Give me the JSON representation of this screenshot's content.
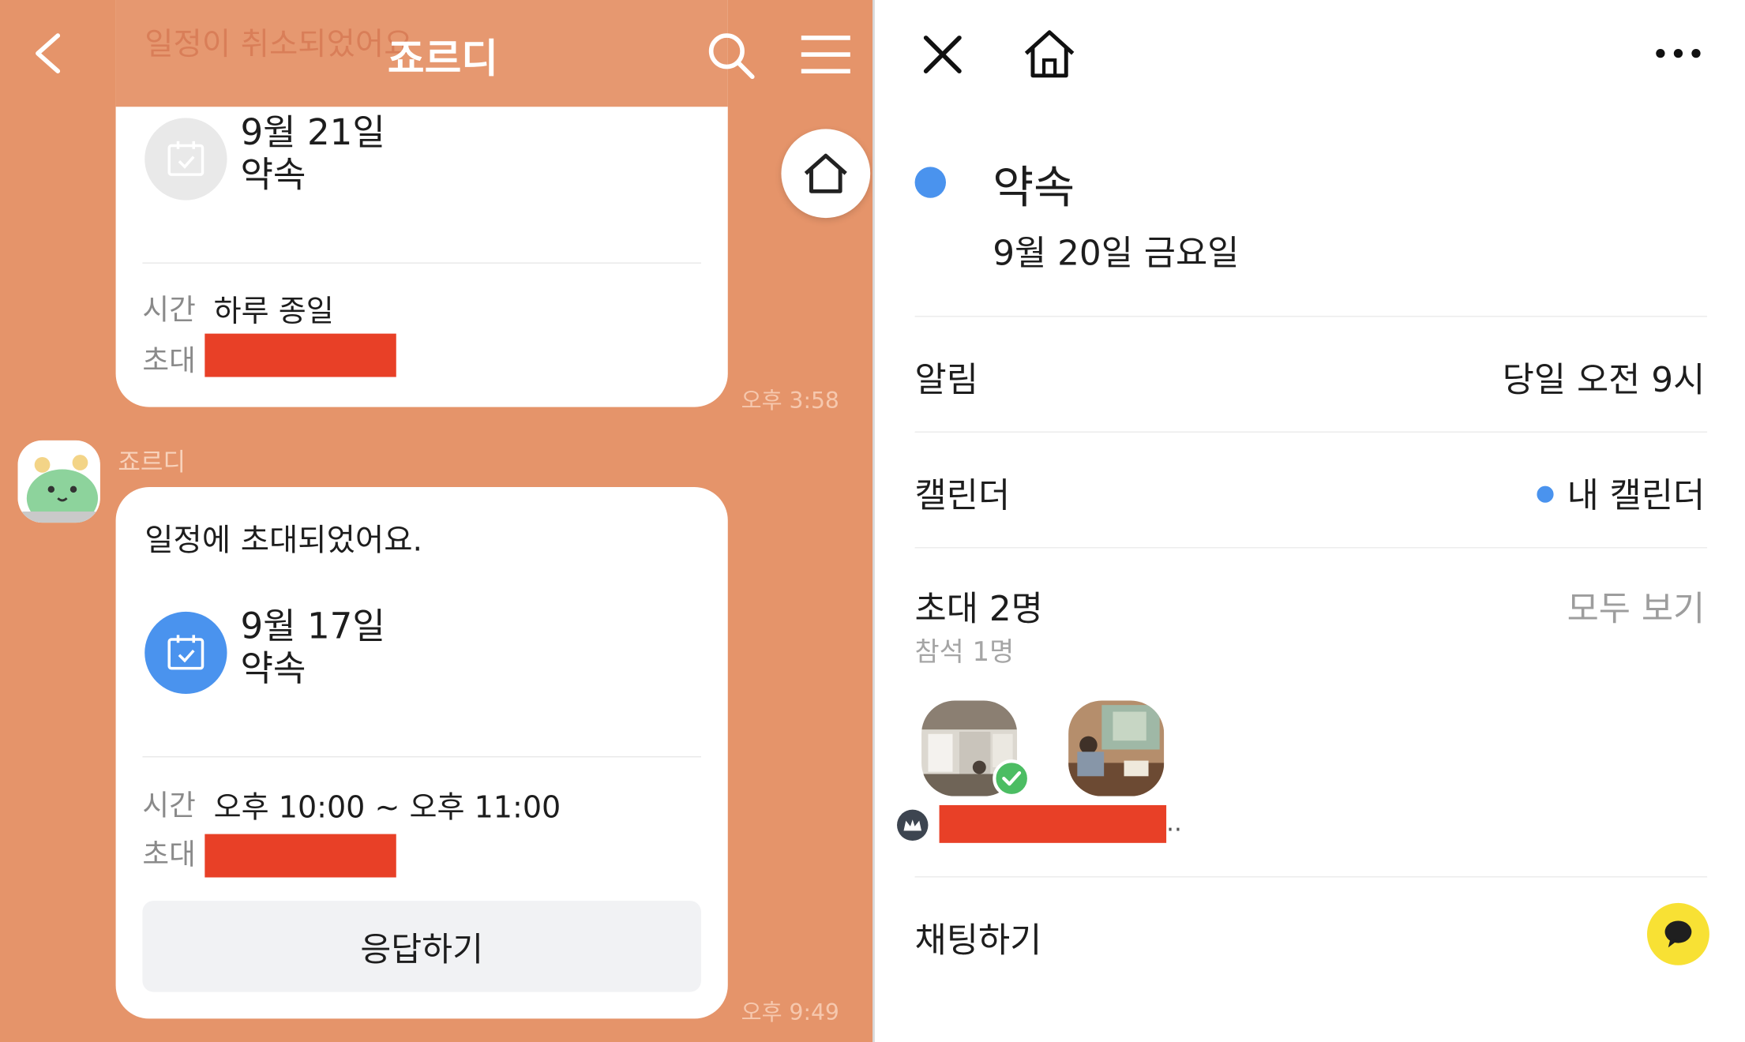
{
  "chat": {
    "title": "죠르디",
    "cancelled_notice": "일정이 취소되었어요",
    "first_event": {
      "date": "9월 21일",
      "name": "약속",
      "time_label": "시간",
      "time_value": "하루 종일",
      "invite_label": "초대",
      "timestamp": "오후 3:58"
    },
    "sender_name": "죠르디",
    "second_event": {
      "message": "일정에 초대되었어요.",
      "date": "9월 17일",
      "name": "약속",
      "time_label": "시간",
      "time_value": "오후 10:00 ~ 오후 11:00",
      "invite_label": "초대",
      "respond_label": "응답하기",
      "timestamp": "오후 9:49"
    }
  },
  "detail": {
    "event_title": "약속",
    "event_date": "9월 20일 금요일",
    "alarm_label": "알림",
    "alarm_value": "당일 오전 9시",
    "calendar_label": "캘린더",
    "calendar_value": "내 캘린더",
    "invite_label": "초대 2명",
    "attend_label": "참석 1명",
    "see_all_label": "모두 보기",
    "ellipsis": "..",
    "chat_label": "채팅하기"
  },
  "colors": {
    "chat_background": "#e5946a",
    "event_accent": "#4a93ee",
    "redaction": "#e84027",
    "chat_button": "#f8e134",
    "attend_check": "#4cbd63"
  }
}
